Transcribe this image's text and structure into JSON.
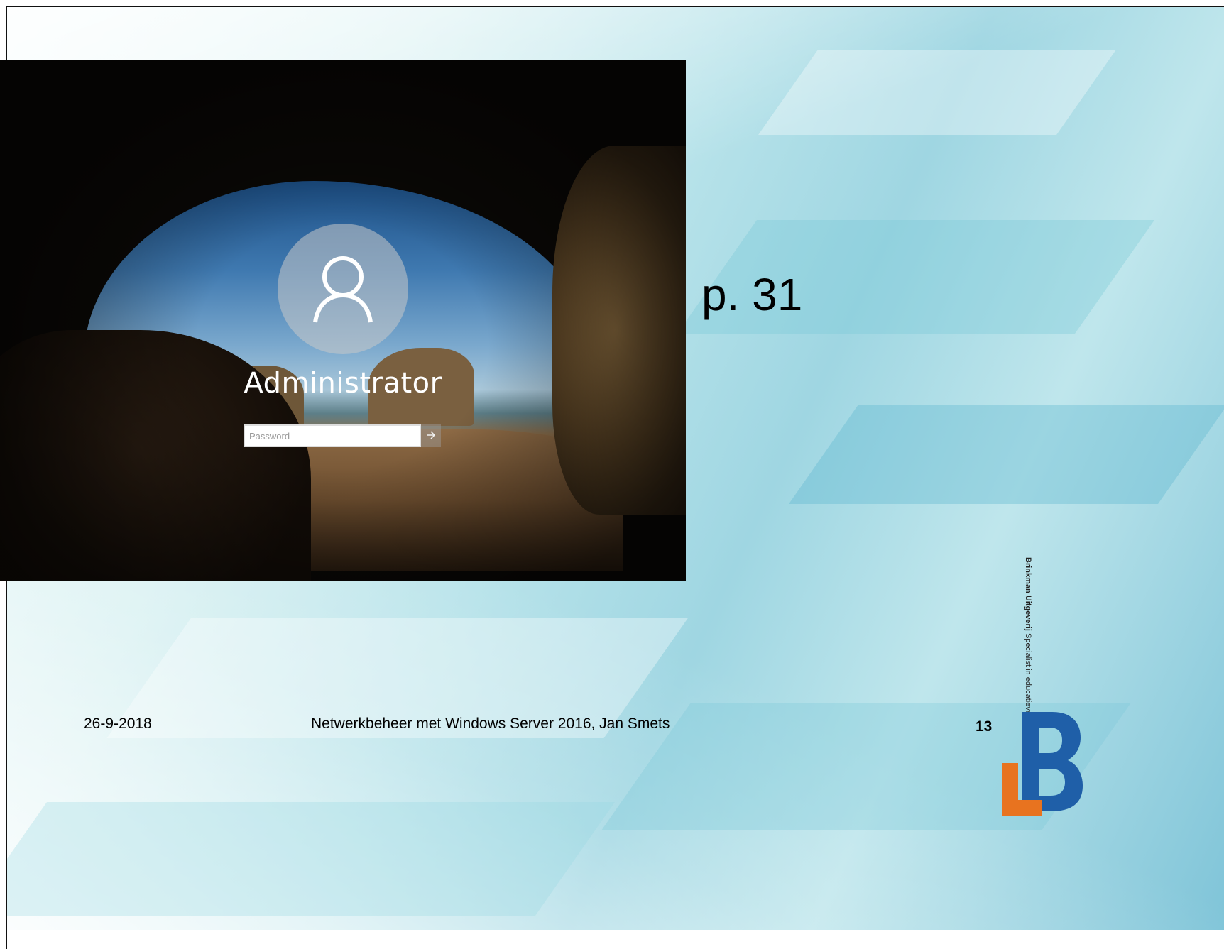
{
  "login_screen": {
    "username": "Administrator",
    "password_placeholder": "Password",
    "submit_icon": "arrow-right-icon",
    "network_icon": "network-icon",
    "power_icon": "power-icon"
  },
  "slide": {
    "page_reference": "p. 31",
    "footer_date": "26-9-2018",
    "footer_title": "Netwerkbeheer met Windows Server 2016, Jan Smets",
    "slide_number": "13",
    "publisher_name": "Brinkman Uitgeverij",
    "publisher_tagline": "Specialist in educatieve uitgaven",
    "logo_colors": {
      "orange": "#e8731f",
      "blue": "#1f5fa8"
    }
  }
}
